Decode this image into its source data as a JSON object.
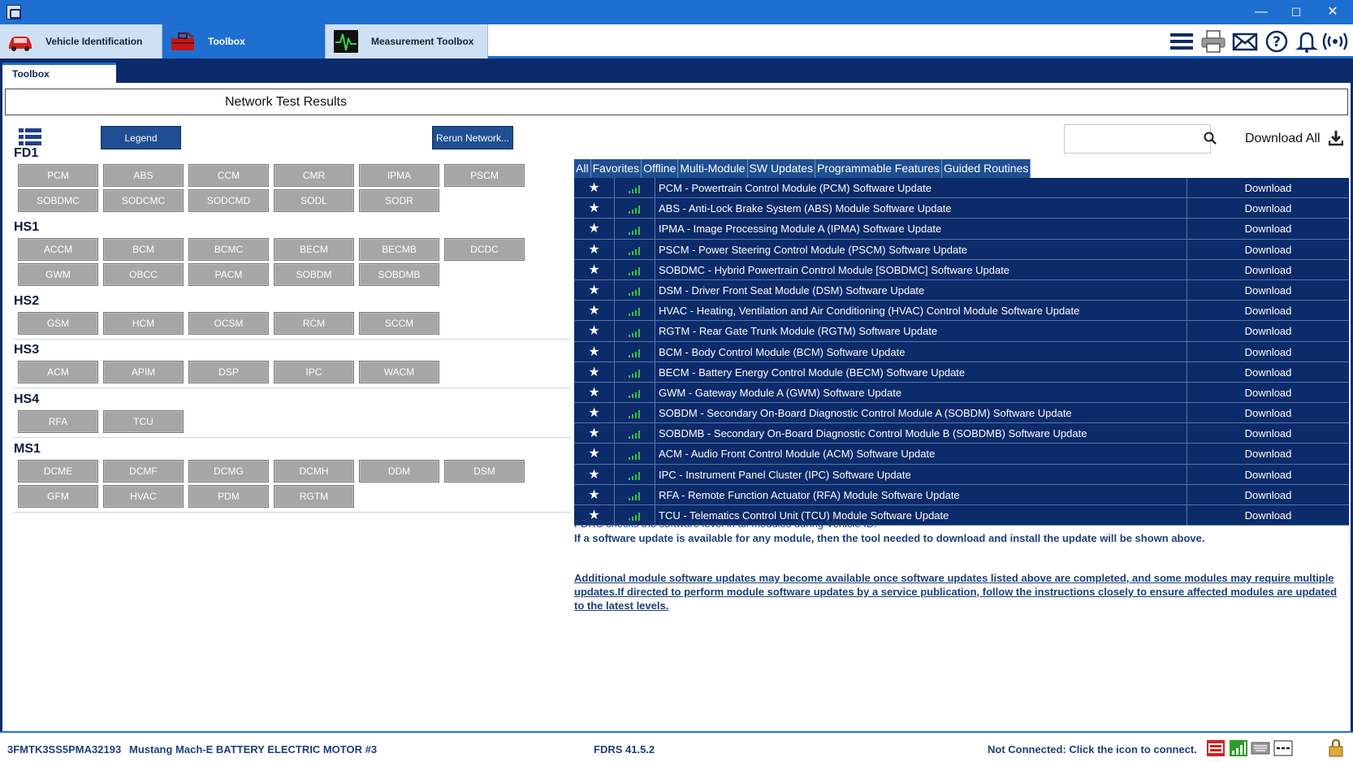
{
  "window": {
    "app_icon": "fdrs-app-icon",
    "controls": {
      "minimize": "—",
      "maximize": "☐",
      "close": "✕"
    }
  },
  "toolbar": {
    "tabs": [
      {
        "label": "Vehicle Identification",
        "icon": "car-icon"
      },
      {
        "label": "Toolbox",
        "icon": "toolbox-icon"
      },
      {
        "label": "Measurement Toolbox",
        "icon": "oscilloscope-icon"
      }
    ],
    "icons": [
      "menu-icon",
      "printer-icon",
      "mail-icon",
      "help-icon",
      "bell-icon",
      "wireless-icon"
    ]
  },
  "subtab": {
    "label": "Toolbox"
  },
  "network": {
    "header": "Network Test Results",
    "legend_label": "Legend",
    "rerun_label": "Rerun Network...",
    "buses": [
      {
        "name": "FD1",
        "modules": [
          "PCM",
          "ABS",
          "CCM",
          "CMR",
          "IPMA",
          "PSCM",
          "SOBDMC",
          "SODCMC",
          "SODCMD",
          "SODL",
          "SODR"
        ]
      },
      {
        "name": "HS1",
        "modules": [
          "ACCM",
          "BCM",
          "BCMC",
          "BECM",
          "BECMB",
          "DCDC",
          "GWM",
          "OBCC",
          "PACM",
          "SOBDM",
          "SOBDMB"
        ]
      },
      {
        "name": "HS2",
        "modules": [
          "GSM",
          "HCM",
          "OCSM",
          "RCM",
          "SCCM"
        ]
      },
      {
        "name": "HS3",
        "modules": [
          "ACM",
          "APIM",
          "DSP",
          "IPC",
          "WACM"
        ]
      },
      {
        "name": "HS4",
        "modules": [
          "RFA",
          "TCU"
        ]
      },
      {
        "name": "MS1",
        "modules": [
          "DCME",
          "DCMF",
          "DCMG",
          "DCMH",
          "DDM",
          "DSM",
          "GFM",
          "HVAC",
          "PDM",
          "RGTM"
        ]
      }
    ]
  },
  "updates": {
    "search_placeholder": "",
    "download_all_label": "Download All",
    "filter_tabs": [
      "All",
      "Favorites",
      "Offline",
      "Multi-Module",
      "SW Updates",
      "Programmable Features",
      "Guided Routines"
    ],
    "rows": [
      {
        "name": "PCM - Powertrain Control Module (PCM) Software Update",
        "action": "Download"
      },
      {
        "name": "ABS - Anti-Lock Brake System (ABS) Module Software Update",
        "action": "Download"
      },
      {
        "name": "IPMA - Image Processing Module A (IPMA) Software Update",
        "action": "Download"
      },
      {
        "name": "PSCM - Power Steering Control Module (PSCM) Software Update",
        "action": "Download"
      },
      {
        "name": "SOBDMC - Hybrid Powertrain Control Module [SOBDMC] Software Update",
        "action": "Download"
      },
      {
        "name": "DSM - Driver Front Seat Module (DSM) Software Update",
        "action": "Download"
      },
      {
        "name": "HVAC - Heating, Ventilation and Air Conditioning (HVAC) Control Module Software Update",
        "action": "Download"
      },
      {
        "name": "RGTM - Rear Gate Trunk Module (RGTM) Software Update",
        "action": "Download"
      },
      {
        "name": "BCM - Body Control Module (BCM) Software Update",
        "action": "Download"
      },
      {
        "name": "BECM - Battery Energy Control Module (BECM) Software Update",
        "action": "Download"
      },
      {
        "name": "GWM - Gateway Module A (GWM) Software Update",
        "action": "Download"
      },
      {
        "name": "SOBDM - Secondary On-Board Diagnostic Control Module A (SOBDM) Software Update",
        "action": "Download"
      },
      {
        "name": "SOBDMB - Secondary On-Board Diagnostic Control Module B (SOBDMB) Software Update",
        "action": "Download"
      },
      {
        "name": "ACM - Audio Front Control Module (ACM) Software Update",
        "action": "Download"
      },
      {
        "name": "IPC - Instrument Panel Cluster (IPC) Software Update",
        "action": "Download"
      },
      {
        "name": "RFA - Remote Function Actuator (RFA) Module Software Update",
        "action": "Download"
      },
      {
        "name": "TCU - Telematics Control Unit (TCU) Module Software Update",
        "action": "Download"
      }
    ],
    "info_line1": "FDRS checks the software level in all modules during Vehicle ID.",
    "info_line2": "If a software update is available for any module, then the tool needed to download and install the update will be shown above.",
    "info_note": "Additional module software updates may become available once software updates listed above are completed, and some modules may require multiple updates.If directed to perform module software updates by a service publication, follow the instructions closely to ensure affected modules are updated to the latest levels."
  },
  "status": {
    "vin": "3FMTK3SS5PMA32193",
    "vehicle": "Mustang Mach-E BATTERY ELECTRIC MOTOR #3",
    "version": "FDRS 41.5.2",
    "connection": "Not Connected: Click the icon to connect.",
    "icons": [
      "vci-connect-icon",
      "signal-icon",
      "keyboard-icon",
      "dashes-icon",
      "lock-icon"
    ]
  },
  "colors": {
    "accent_blue": "#1e6fd0",
    "navy": "#0b2b6a",
    "module_gray": "#a6a6a6",
    "signal_green": "#39c13e"
  }
}
